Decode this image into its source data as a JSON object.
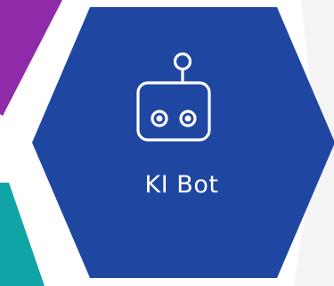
{
  "tile": {
    "label": "KI Bot",
    "icon": "robot-icon"
  },
  "colors": {
    "background": "#ffffff",
    "right_panel": "#f4f4f4",
    "purple_tile": "#8f2aa8",
    "teal_tile": "#10a4a6",
    "main_tile": "#1f47a1",
    "icon_stroke": "#ffffff"
  }
}
